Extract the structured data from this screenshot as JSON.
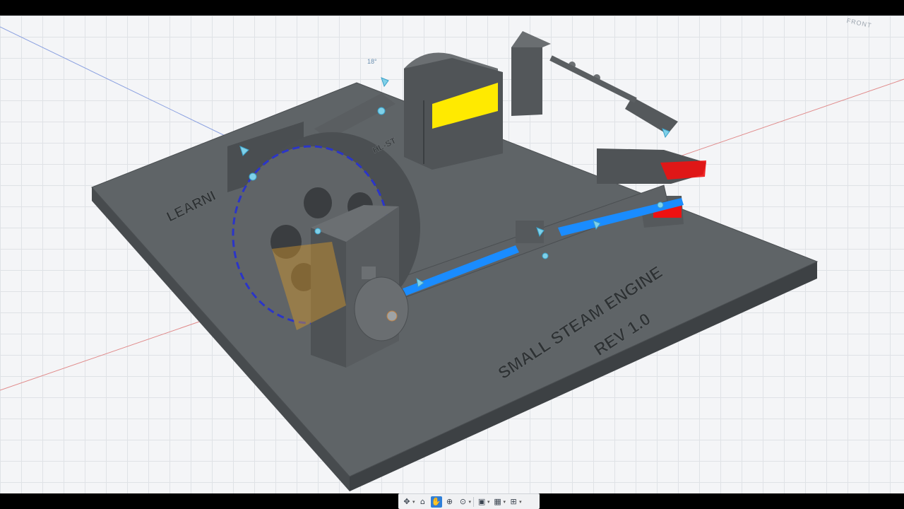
{
  "viewport": {
    "angle_label": "18°",
    "viewcube_label": "FRONT"
  },
  "model_text": {
    "left_partial": "LEARNI",
    "flywheel_partial": "HL-ST",
    "title_line1": "SMALL STEAM ENGINE",
    "title_line2": "REV 1.0"
  },
  "toolbar": {
    "items": [
      {
        "icon": "orbit-icon",
        "glyph": "✥"
      },
      {
        "icon": "look-at-icon",
        "glyph": "⌂"
      },
      {
        "icon": "pan-icon",
        "glyph": "✋"
      },
      {
        "icon": "zoom-icon",
        "glyph": "⊕"
      },
      {
        "icon": "zoom-window-icon",
        "glyph": "⊙"
      },
      {
        "icon": "display-settings-icon",
        "glyph": "▣"
      },
      {
        "icon": "grid-icon",
        "glyph": "▦"
      },
      {
        "icon": "viewports-icon",
        "glyph": "⊞"
      }
    ]
  },
  "colors": {
    "base": "#5e6366",
    "highlight_blue": "#1a8cff",
    "highlight_yellow": "#ffea00",
    "highlight_red": "#ee1111"
  }
}
